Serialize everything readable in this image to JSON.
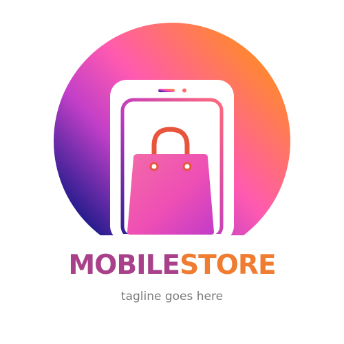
{
  "logo": {
    "word_1": "MOBILE",
    "word_2": "STORE",
    "tagline": "tagline goes here",
    "icon": "smartphone-with-shopping-bag-icon",
    "colors": {
      "word_1": "#a8418a",
      "word_2": "#f07c32",
      "tagline": "#7a7a7a",
      "gradient_pink": "#ff5ab0",
      "gradient_orange": "#ff8a2a",
      "gradient_indigo": "#2a1d8f",
      "bag_handle": "#e8553c"
    }
  }
}
